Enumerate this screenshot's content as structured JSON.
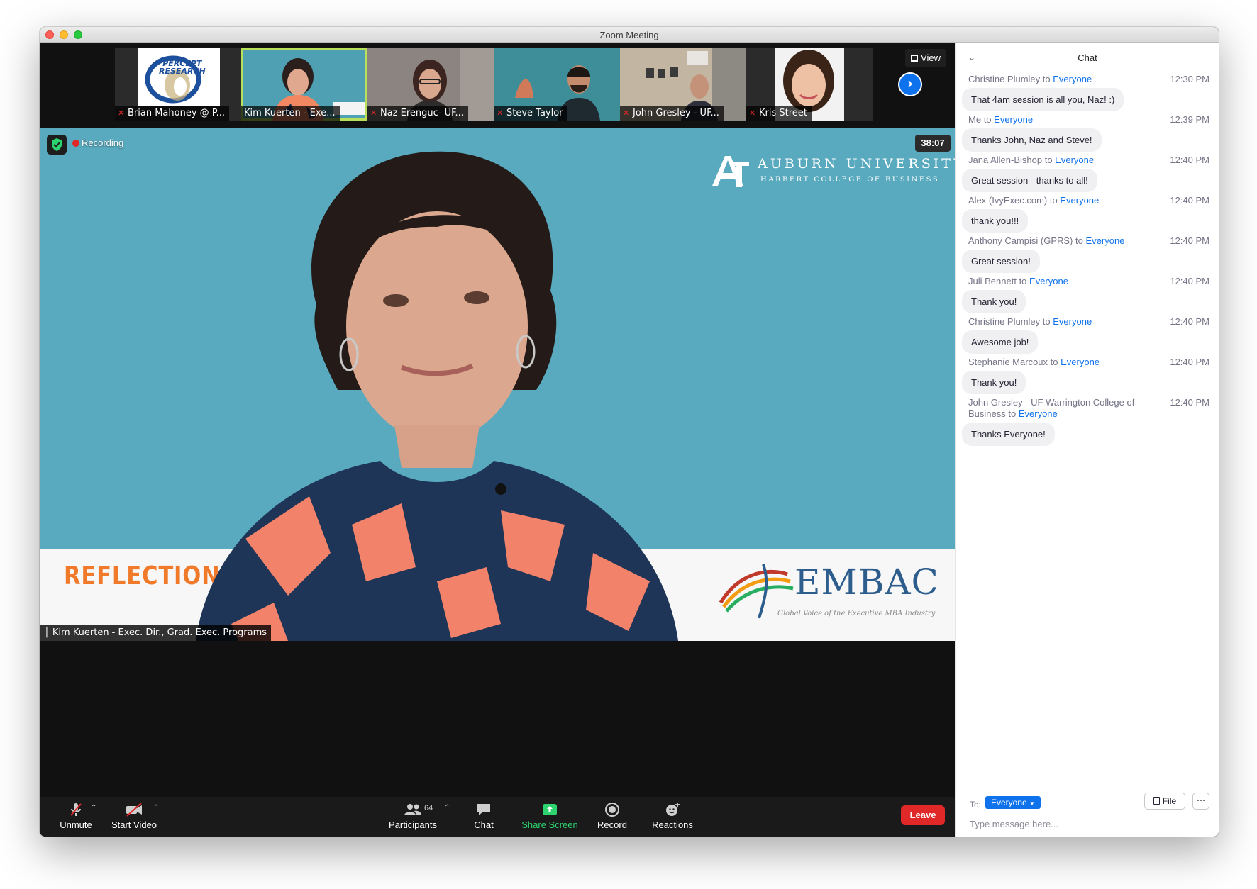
{
  "window": {
    "title": "Zoom Meeting"
  },
  "gallery": {
    "thumbnails": [
      {
        "name": "Brian Mahoney @ P...",
        "muted": true,
        "logo_line1": "PERCEPT",
        "logo_line2": "RESEARCH"
      },
      {
        "name": "Kim Kuerten - Exe...",
        "muted": false
      },
      {
        "name": "Naz Erenguc- UF...",
        "muted": true
      },
      {
        "name": "Steve Taylor",
        "muted": true
      },
      {
        "name": "John Gresley - UF...",
        "muted": true
      },
      {
        "name": "Kris Street",
        "muted": true
      }
    ],
    "view_label": "View"
  },
  "stage": {
    "recording_label": "Recording",
    "timer": "38:07",
    "speaker_name": "Kim Kuerten - Exec. Dir., Grad. Exec. Programs",
    "banner_text": "REFLECTION",
    "auburn_name": "AUBURN UNIVERSITY",
    "auburn_sub": "HARBERT COLLEGE OF BUSINESS",
    "embac_name": "EMBAC",
    "embac_tagline": "Global Voice of the Executive MBA Industry"
  },
  "toolbar": {
    "unmute": "Unmute",
    "start_video": "Start Video",
    "participants": "Participants",
    "participant_count": "64",
    "chat": "Chat",
    "share_screen": "Share Screen",
    "record": "Record",
    "reactions": "Reactions",
    "leave": "Leave"
  },
  "chat": {
    "title": "Chat",
    "messages": [
      {
        "from": "Christine Plumley",
        "to": "Everyone",
        "time": "12:30 PM",
        "text": "That 4am session is all you, Naz! :)"
      },
      {
        "from": "Me",
        "to": "Everyone",
        "time": "12:39 PM",
        "text": "Thanks John, Naz and Steve!"
      },
      {
        "from": "Jana Allen-Bishop",
        "to": "Everyone",
        "time": "12:40 PM",
        "text": "Great session - thanks to all!"
      },
      {
        "from": "Alex (IvyExec.com)",
        "to": "Everyone",
        "time": "12:40 PM",
        "text": "thank you!!!"
      },
      {
        "from": "Anthony Campisi (GPRS)",
        "to": "Everyone",
        "time": "12:40 PM",
        "text": "Great session!"
      },
      {
        "from": "Juli Bennett",
        "to": "Everyone",
        "time": "12:40 PM",
        "text": "Thank you!"
      },
      {
        "from": "Christine Plumley",
        "to": "Everyone",
        "time": "12:40 PM",
        "text": "Awesome job!"
      },
      {
        "from": "Stephanie Marcoux",
        "to": "Everyone",
        "time": "12:40 PM",
        "text": "Thank you!"
      },
      {
        "from": "John Gresley - UF Warrington College of Business",
        "to": "Everyone",
        "time": "12:40 PM",
        "text": "Thanks Everyone!"
      }
    ],
    "to_word": "to",
    "footer": {
      "to_label": "To:",
      "recipient": "Everyone",
      "file_label": "File",
      "more_label": "⋯",
      "placeholder": "Type message here..."
    }
  },
  "colors": {
    "accent": "#0e72ed",
    "leave": "#e02828",
    "share_green": "#2dd36f",
    "stage_bg": "#59aabf",
    "active_outline": "#b8e05a"
  },
  "icons": [
    "mic-muted-icon",
    "video-off-icon",
    "participants-icon",
    "chat-icon",
    "share-screen-icon",
    "record-icon",
    "reactions-icon",
    "shield-icon",
    "grid-icon",
    "chevron-right-icon",
    "chevron-down-icon",
    "file-icon"
  ]
}
